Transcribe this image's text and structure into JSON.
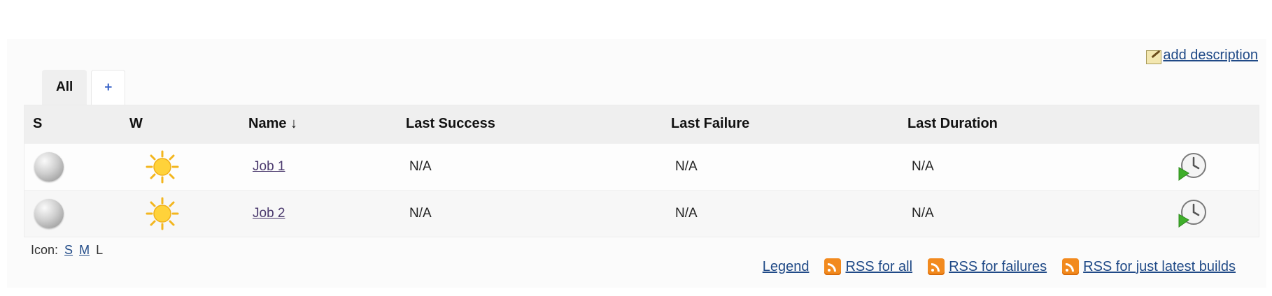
{
  "header": {
    "add_description_label": "add description",
    "note_icon": "edit-note-icon"
  },
  "tabs": [
    {
      "label": "All"
    },
    {
      "label": "+"
    }
  ],
  "table": {
    "columns": {
      "s": "S",
      "w": "W",
      "name": "Name",
      "sort_indicator": "↓",
      "last_success": "Last Success",
      "last_failure": "Last Failure",
      "last_duration": "Last Duration"
    },
    "rows": [
      {
        "name": "Job 1",
        "last_success": "N/A",
        "last_failure": "N/A",
        "last_duration": "N/A",
        "status_icon": "grey-ball-icon",
        "weather_icon": "sunny-weather-icon",
        "action_icon": "schedule-build-icon"
      },
      {
        "name": "Job 2",
        "last_success": "N/A",
        "last_failure": "N/A",
        "last_duration": "N/A",
        "status_icon": "grey-ball-icon",
        "weather_icon": "sunny-weather-icon",
        "action_icon": "schedule-build-icon"
      }
    ]
  },
  "icon_size": {
    "label": "Icon:",
    "small": "S",
    "medium": "M",
    "large": "L"
  },
  "footer": {
    "legend": "Legend",
    "rss_all": "RSS for all",
    "rss_failures": "RSS for failures",
    "rss_latest": "RSS for just latest builds"
  },
  "colors": {
    "link": "#204a87",
    "rss": "#f28a1e",
    "header_bg": "#efefef"
  }
}
